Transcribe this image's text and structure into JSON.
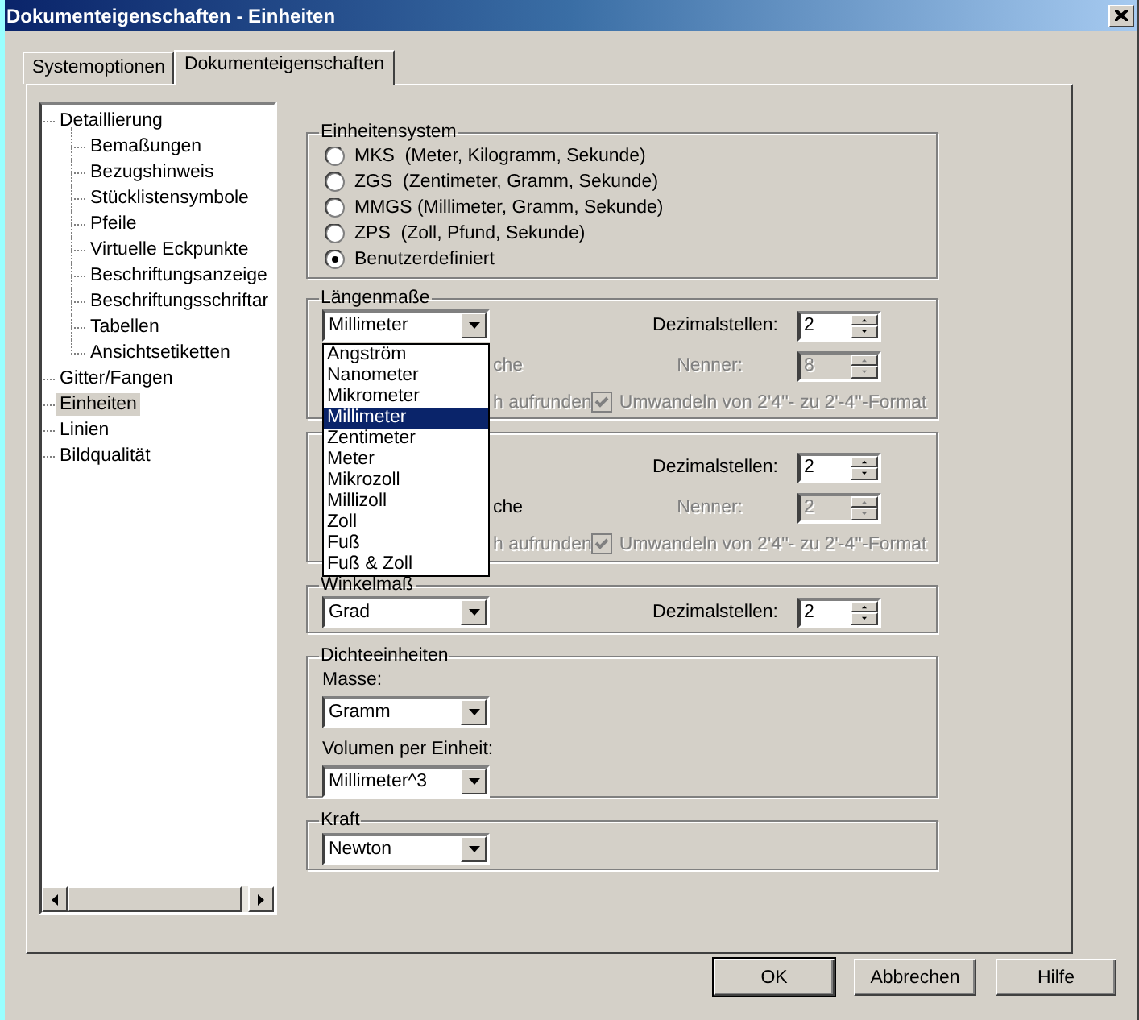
{
  "window": {
    "title": "Dokumenteigenschaften - Einheiten"
  },
  "tabs": [
    {
      "label": "Systemoptionen",
      "selected": false
    },
    {
      "label": "Dokumenteigenschaften",
      "selected": true
    }
  ],
  "tree": [
    {
      "label": "Detaillierung",
      "selected": false,
      "children": [
        {
          "label": "Bemaßungen",
          "selected": false
        },
        {
          "label": "Bezugshinweis",
          "selected": false
        },
        {
          "label": "Stücklistensymbole",
          "selected": false
        },
        {
          "label": "Pfeile",
          "selected": false
        },
        {
          "label": "Virtuelle Eckpunkte",
          "selected": false
        },
        {
          "label": "Beschriftungsanzeige",
          "selected": false
        },
        {
          "label": "Beschriftungsschriftar",
          "selected": false
        },
        {
          "label": "Tabellen",
          "selected": false
        },
        {
          "label": "Ansichtsetiketten",
          "selected": false
        }
      ]
    },
    {
      "label": "Gitter/Fangen",
      "selected": false
    },
    {
      "label": "Einheiten",
      "selected": true
    },
    {
      "label": "Linien",
      "selected": false
    },
    {
      "label": "Bildqualität",
      "selected": false
    }
  ],
  "unit_system": {
    "title": "Einheitensystem",
    "options": [
      {
        "label": "MKS  (Meter, Kilogramm, Sekunde)",
        "selected": false
      },
      {
        "label": "ZGS  (Zentimeter, Gramm, Sekunde)",
        "selected": false
      },
      {
        "label": "MMGS (Millimeter, Gramm, Sekunde)",
        "selected": false
      },
      {
        "label": "ZPS  (Zoll, Pfund, Sekunde)",
        "selected": false
      },
      {
        "label": "Benutzerdefiniert",
        "selected": true
      }
    ]
  },
  "length_groups": [
    {
      "title": "Längenmaße",
      "unit": "Millimeter",
      "decimals_label": "Dezimalstellen:",
      "decimals": "2",
      "fraction_text": {
        "text": "che",
        "disabled": true
      },
      "denominator_label": "Nenner:",
      "denominator": "8",
      "denominator_disabled": true,
      "round_text": {
        "text": "h aufrunden",
        "disabled": true
      },
      "convert": {
        "label": "Umwandeln von 2'4''- zu 2'-4''-Format",
        "checked": true,
        "disabled": true
      }
    },
    {
      "decimals_label": "Dezimalstellen:",
      "decimals": "2",
      "fraction_text": {
        "text": "che",
        "disabled": false
      },
      "denominator_label": "Nenner:",
      "denominator": "2",
      "denominator_disabled": true,
      "round_text": {
        "text": "h aufrunden",
        "disabled": true
      },
      "convert": {
        "label": "Umwandeln von 2'4''- zu 2'-4''-Format",
        "checked": true,
        "disabled": true
      }
    }
  ],
  "angle_units": {
    "title": "Winkelmaß",
    "unit": "Grad",
    "decimals_label": "Dezimalstellen:",
    "decimals": "2"
  },
  "density_units": {
    "title": "Dichteeinheiten",
    "mass_label": "Masse:",
    "mass": "Gramm",
    "volume_label": "Volumen per Einheit:",
    "volume": "Millimeter^3"
  },
  "force_units": {
    "title": "Kraft",
    "unit": "Newton"
  },
  "dropdown_list": {
    "items": [
      {
        "label": "Angström",
        "selected": false
      },
      {
        "label": "Nanometer",
        "selected": false
      },
      {
        "label": "Mikrometer",
        "selected": false
      },
      {
        "label": "Millimeter",
        "selected": true
      },
      {
        "label": "Zentimeter",
        "selected": false
      },
      {
        "label": "Meter",
        "selected": false
      },
      {
        "label": "Mikrozoll",
        "selected": false
      },
      {
        "label": "Millizoll",
        "selected": false
      },
      {
        "label": "Zoll",
        "selected": false
      },
      {
        "label": "Fuß",
        "selected": false
      },
      {
        "label": "Fuß & Zoll",
        "selected": false
      }
    ]
  },
  "buttons": [
    {
      "label": "OK",
      "default": true
    },
    {
      "label": "Abbrechen",
      "default": false
    },
    {
      "label": "Hilfe",
      "default": false
    }
  ]
}
